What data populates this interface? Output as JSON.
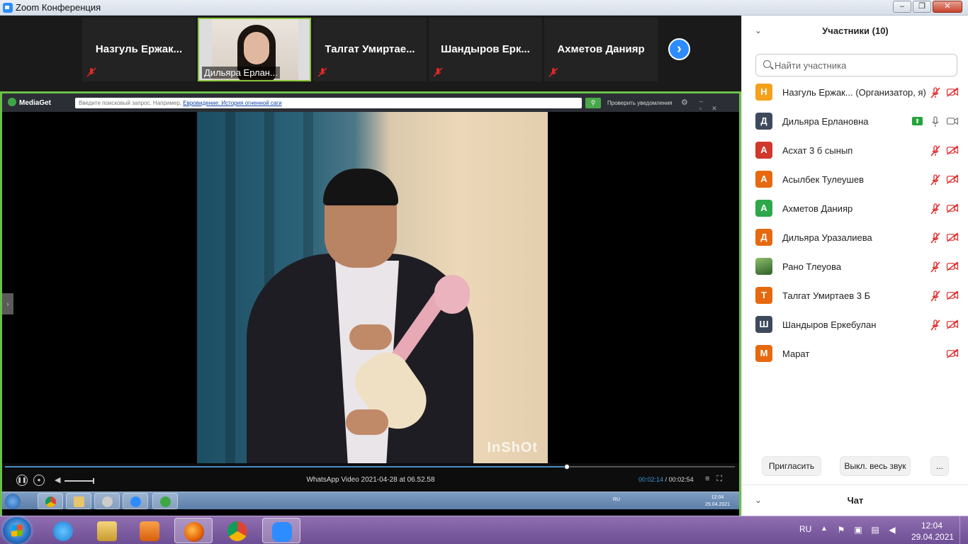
{
  "window": {
    "title": "Zoom Конференция",
    "buttons": [
      "–",
      "❐",
      "✕"
    ]
  },
  "video_strip": {
    "tiles": [
      {
        "name": "Назгуль  Ержак...",
        "muted": true
      },
      {
        "name": "Дильяра Ерлан...",
        "muted": false,
        "active": true
      },
      {
        "name": "Талгат  Умиртае...",
        "muted": true
      },
      {
        "name": "Шандыров  Ерк...",
        "muted": true
      },
      {
        "name": "Ахметов Данияр",
        "muted": true
      }
    ],
    "next_label": "›"
  },
  "shared_screen": {
    "app_name": "MediaGet",
    "search_placeholder": "Введите поисковый запрос. Например,",
    "search_example": "Евровидение: История огненной саги",
    "notify_label": "Проверить уведомления",
    "video_watermark": "InShOt",
    "player": {
      "filename": "WhatsApp Video 2021-04-28 at 06.52.58",
      "current_time": "00:02:14",
      "separator": " / ",
      "total_time": "00:02:54",
      "progress": 0.77
    },
    "taskbar": {
      "lang": "RU",
      "time": "12:04",
      "date": "29.04.2021"
    }
  },
  "participants_panel": {
    "title": "Участники (10)",
    "search_placeholder": "Найти участника",
    "participants": [
      {
        "initial": "Н",
        "name": "Назгуль Ержак...  (Организатор, я)",
        "color": "#f5a11b",
        "mic": "off",
        "cam": "off"
      },
      {
        "initial": "Д",
        "name": "Дильяра Ерлановна",
        "color": "#3e4a5c",
        "mic": "on",
        "cam": "on",
        "sharing": true
      },
      {
        "initial": "А",
        "name": "Асхат 3 б сынып",
        "color": "#d0382c",
        "mic": "off",
        "cam": "off"
      },
      {
        "initial": "А",
        "name": "Асылбек Тулеушев",
        "color": "#e6690f",
        "mic": "off",
        "cam": "off"
      },
      {
        "initial": "А",
        "name": "Ахметов Данияр",
        "color": "#2ca84a",
        "mic": "off",
        "cam": "off"
      },
      {
        "initial": "Д",
        "name": "Дильяра Уразалиева",
        "color": "#e6690f",
        "mic": "off",
        "cam": "off"
      },
      {
        "initial": "",
        "name": "Рано Тлеуова",
        "color": "#4d7a3a",
        "mic": "off",
        "cam": "off",
        "photo": true
      },
      {
        "initial": "Т",
        "name": "Талгат Умиртаев 3 Б",
        "color": "#e6690f",
        "mic": "off",
        "cam": "off"
      },
      {
        "initial": "Ш",
        "name": "Шандыров Еркебулан",
        "color": "#3e4a5c",
        "mic": "off",
        "cam": "off"
      },
      {
        "initial": "М",
        "name": "Марат",
        "color": "#e6690f",
        "mic": "none",
        "cam": "off"
      }
    ],
    "actions": {
      "invite": "Пригласить",
      "mute_all": "Выкл. весь звук",
      "more": "..."
    },
    "chat_title": "Чат"
  },
  "taskbar": {
    "lang": "RU",
    "time": "12:04",
    "date": "29.04.2021"
  },
  "colors": {
    "zoom_blue": "#2d8cff",
    "share_border": "#6cc04a",
    "muted_red": "#e02828",
    "taskbar": "#7c5ca2"
  }
}
